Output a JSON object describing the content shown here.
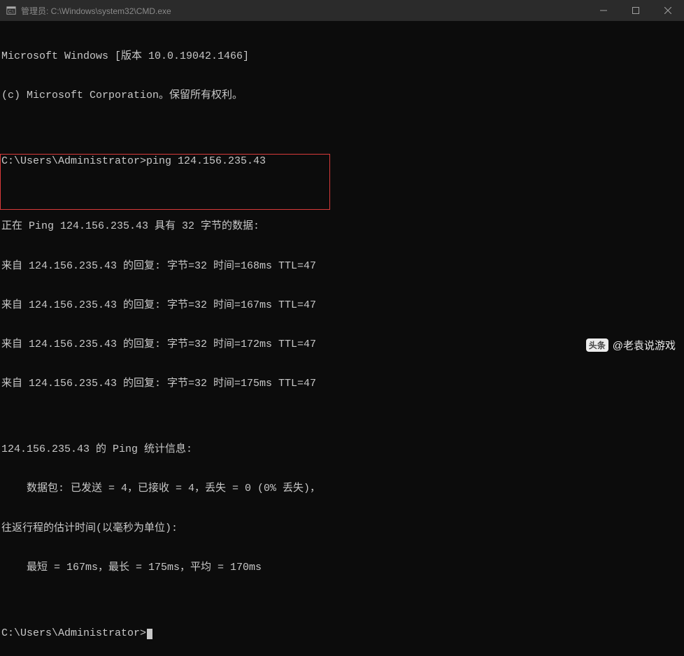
{
  "titlebar": {
    "title": "管理员: C:\\Windows\\system32\\CMD.exe"
  },
  "terminal": {
    "header1": "Microsoft Windows [版本 10.0.19042.1466]",
    "header2": "(c) Microsoft Corporation。保留所有权利。",
    "blank1": "",
    "prompt1": "C:\\Users\\Administrator>ping 124.156.235.43",
    "blank2": "",
    "ping_hdr": "正在 Ping 124.156.235.43 具有 32 字节的数据:",
    "reply1": "来自 124.156.235.43 的回复: 字节=32 时间=168ms TTL=47",
    "reply2": "来自 124.156.235.43 的回复: 字节=32 时间=167ms TTL=47",
    "reply3": "来自 124.156.235.43 的回复: 字节=32 时间=172ms TTL=47",
    "reply4": "来自 124.156.235.43 的回复: 字节=32 时间=175ms TTL=47",
    "blank3": "",
    "stats_hdr": "124.156.235.43 的 Ping 统计信息:",
    "stats_packets": "    数据包: 已发送 = 4，已接收 = 4，丢失 = 0 (0% 丢失)，",
    "stats_rtt_hdr": "往返行程的估计时间(以毫秒为单位):",
    "stats_rtt": "    最短 = 167ms，最长 = 175ms，平均 = 170ms",
    "blank4": "",
    "prompt2": "C:\\Users\\Administrator>"
  },
  "watermark": {
    "badge": "头条",
    "text": "@老袁说游戏"
  }
}
